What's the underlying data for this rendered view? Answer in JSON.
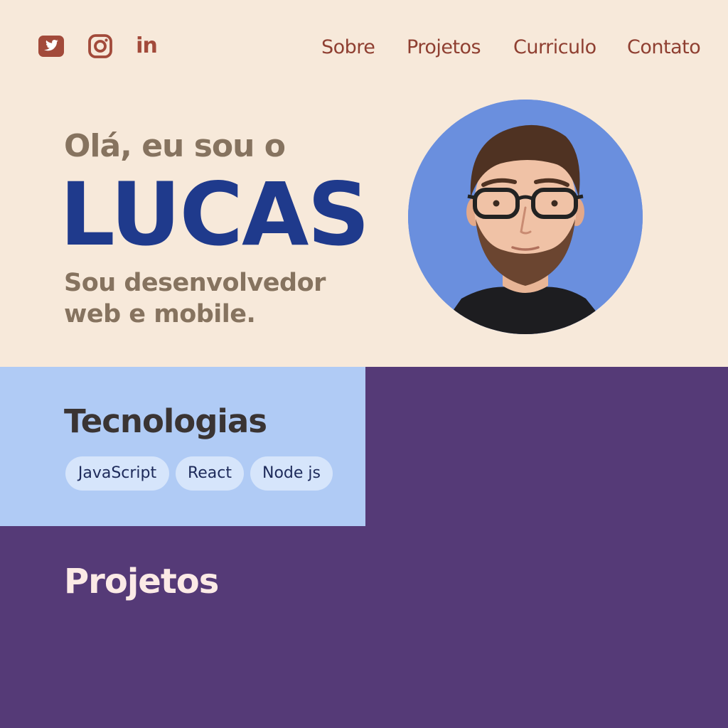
{
  "social": {
    "icons": [
      "twitter-icon",
      "instagram-icon",
      "linkedin-icon"
    ],
    "linkedin_text": "in"
  },
  "nav": {
    "items": [
      "Sobre",
      "Projetos",
      "Curriculo",
      "Contato"
    ]
  },
  "hero": {
    "greeting": "Olá, eu sou o",
    "name": "LUCAS",
    "subtitle": "Sou desenvolvedor web e mobile."
  },
  "technologies": {
    "title": "Tecnologias",
    "chips": [
      "JavaScript",
      "React",
      "Node js"
    ]
  },
  "projects": {
    "title": "Projetos"
  },
  "colors": {
    "background": "#f7e9da",
    "accent": "#8f3f31",
    "name_blue": "#1f3a8c",
    "muted_text": "#86735f",
    "tech_bg": "#b0cbf5",
    "purple": "#553a77",
    "avatar_bg": "#6a8fde"
  }
}
